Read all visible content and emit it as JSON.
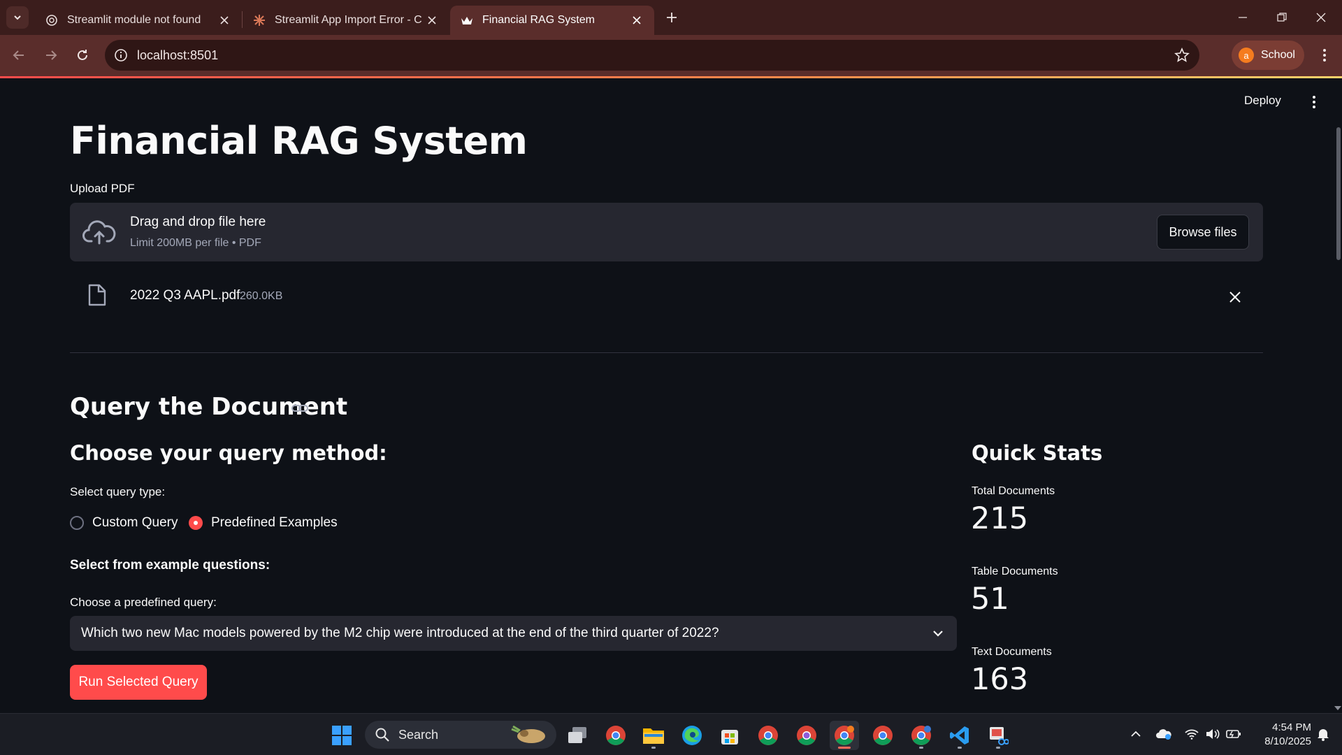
{
  "browser": {
    "tabs": [
      {
        "title": "Streamlit module not found",
        "active": false
      },
      {
        "title": "Streamlit App Import Error - Cla",
        "active": false
      },
      {
        "title": "Financial RAG System",
        "active": true
      }
    ],
    "url": "localhost:8501",
    "profile_name": "School",
    "profile_initial": "a"
  },
  "app": {
    "deploy_label": "Deploy",
    "title": "Financial RAG System",
    "upload_label": "Upload PDF",
    "dropzone": {
      "main": "Drag and drop file here",
      "sub": "Limit 200MB per file • PDF",
      "browse_label": "Browse files"
    },
    "uploaded_file": {
      "name": "2022 Q3 AAPL.pdf",
      "size": "260.0KB"
    },
    "query_section": {
      "heading": "Query the Document",
      "method_heading": "Choose your query method:",
      "type_label": "Select query type:",
      "options": [
        "Custom Query",
        "Predefined Examples"
      ],
      "selected_option": "Predefined Examples",
      "examples_heading": "Select from example questions:",
      "select_label": "Choose a predefined query:",
      "selected_query": "Which two new Mac models powered by the M2 chip were introduced at the end of the third quarter of 2022?",
      "run_label": "Run Selected Query"
    },
    "stats": {
      "heading": "Quick Stats",
      "metrics": [
        {
          "label": "Total Documents",
          "value": "215"
        },
        {
          "label": "Table Documents",
          "value": "51"
        },
        {
          "label": "Text Documents",
          "value": "163"
        }
      ]
    },
    "colors": {
      "accent": "#ff4b4b",
      "background": "#0e1117",
      "surface": "#262730"
    }
  },
  "taskbar": {
    "search_label": "Search",
    "time": "4:54 PM",
    "date": "8/10/2025",
    "apps": [
      "file-explorer-icon",
      "chrome-icon",
      "folder-icon",
      "edge-icon",
      "store-icon",
      "chrome-icon",
      "chrome-icon",
      "chrome-icon",
      "chrome-icon",
      "chrome-icon",
      "vscode-icon",
      "snipping-tool-icon"
    ]
  }
}
